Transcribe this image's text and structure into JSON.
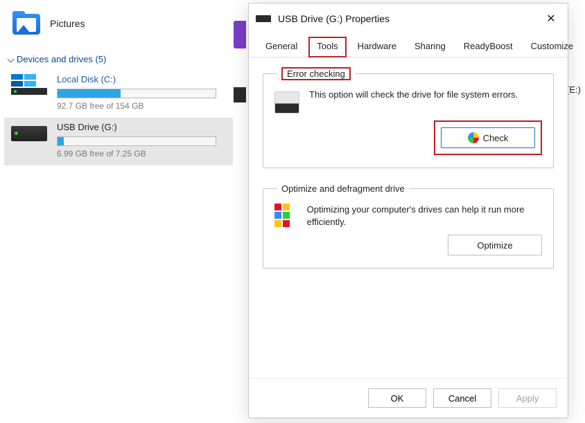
{
  "explorer": {
    "pictures_label": "Pictures",
    "section_header": "Devices and drives (5)",
    "drives": [
      {
        "name": "Local Disk (C:)",
        "free_text": "92.7 GB free of 154 GB",
        "fill_percent": 40
      },
      {
        "name": "USB Drive (G:)",
        "free_text": "6.99 GB free of 7.25 GB",
        "fill_percent": 4
      }
    ],
    "truncated_drive_letter": "(E:)"
  },
  "dialog": {
    "title": "USB Drive (G:) Properties",
    "tabs": [
      "General",
      "Tools",
      "Hardware",
      "Sharing",
      "ReadyBoost",
      "Customize"
    ],
    "active_tab_index": 1,
    "error_check": {
      "legend": "Error checking",
      "description": "This option will check the drive for file system errors.",
      "button": "Check"
    },
    "optimize": {
      "legend": "Optimize and defragment drive",
      "description": "Optimizing your computer's drives can help it run more efficiently.",
      "button": "Optimize"
    },
    "buttons": {
      "ok": "OK",
      "cancel": "Cancel",
      "apply": "Apply"
    }
  }
}
